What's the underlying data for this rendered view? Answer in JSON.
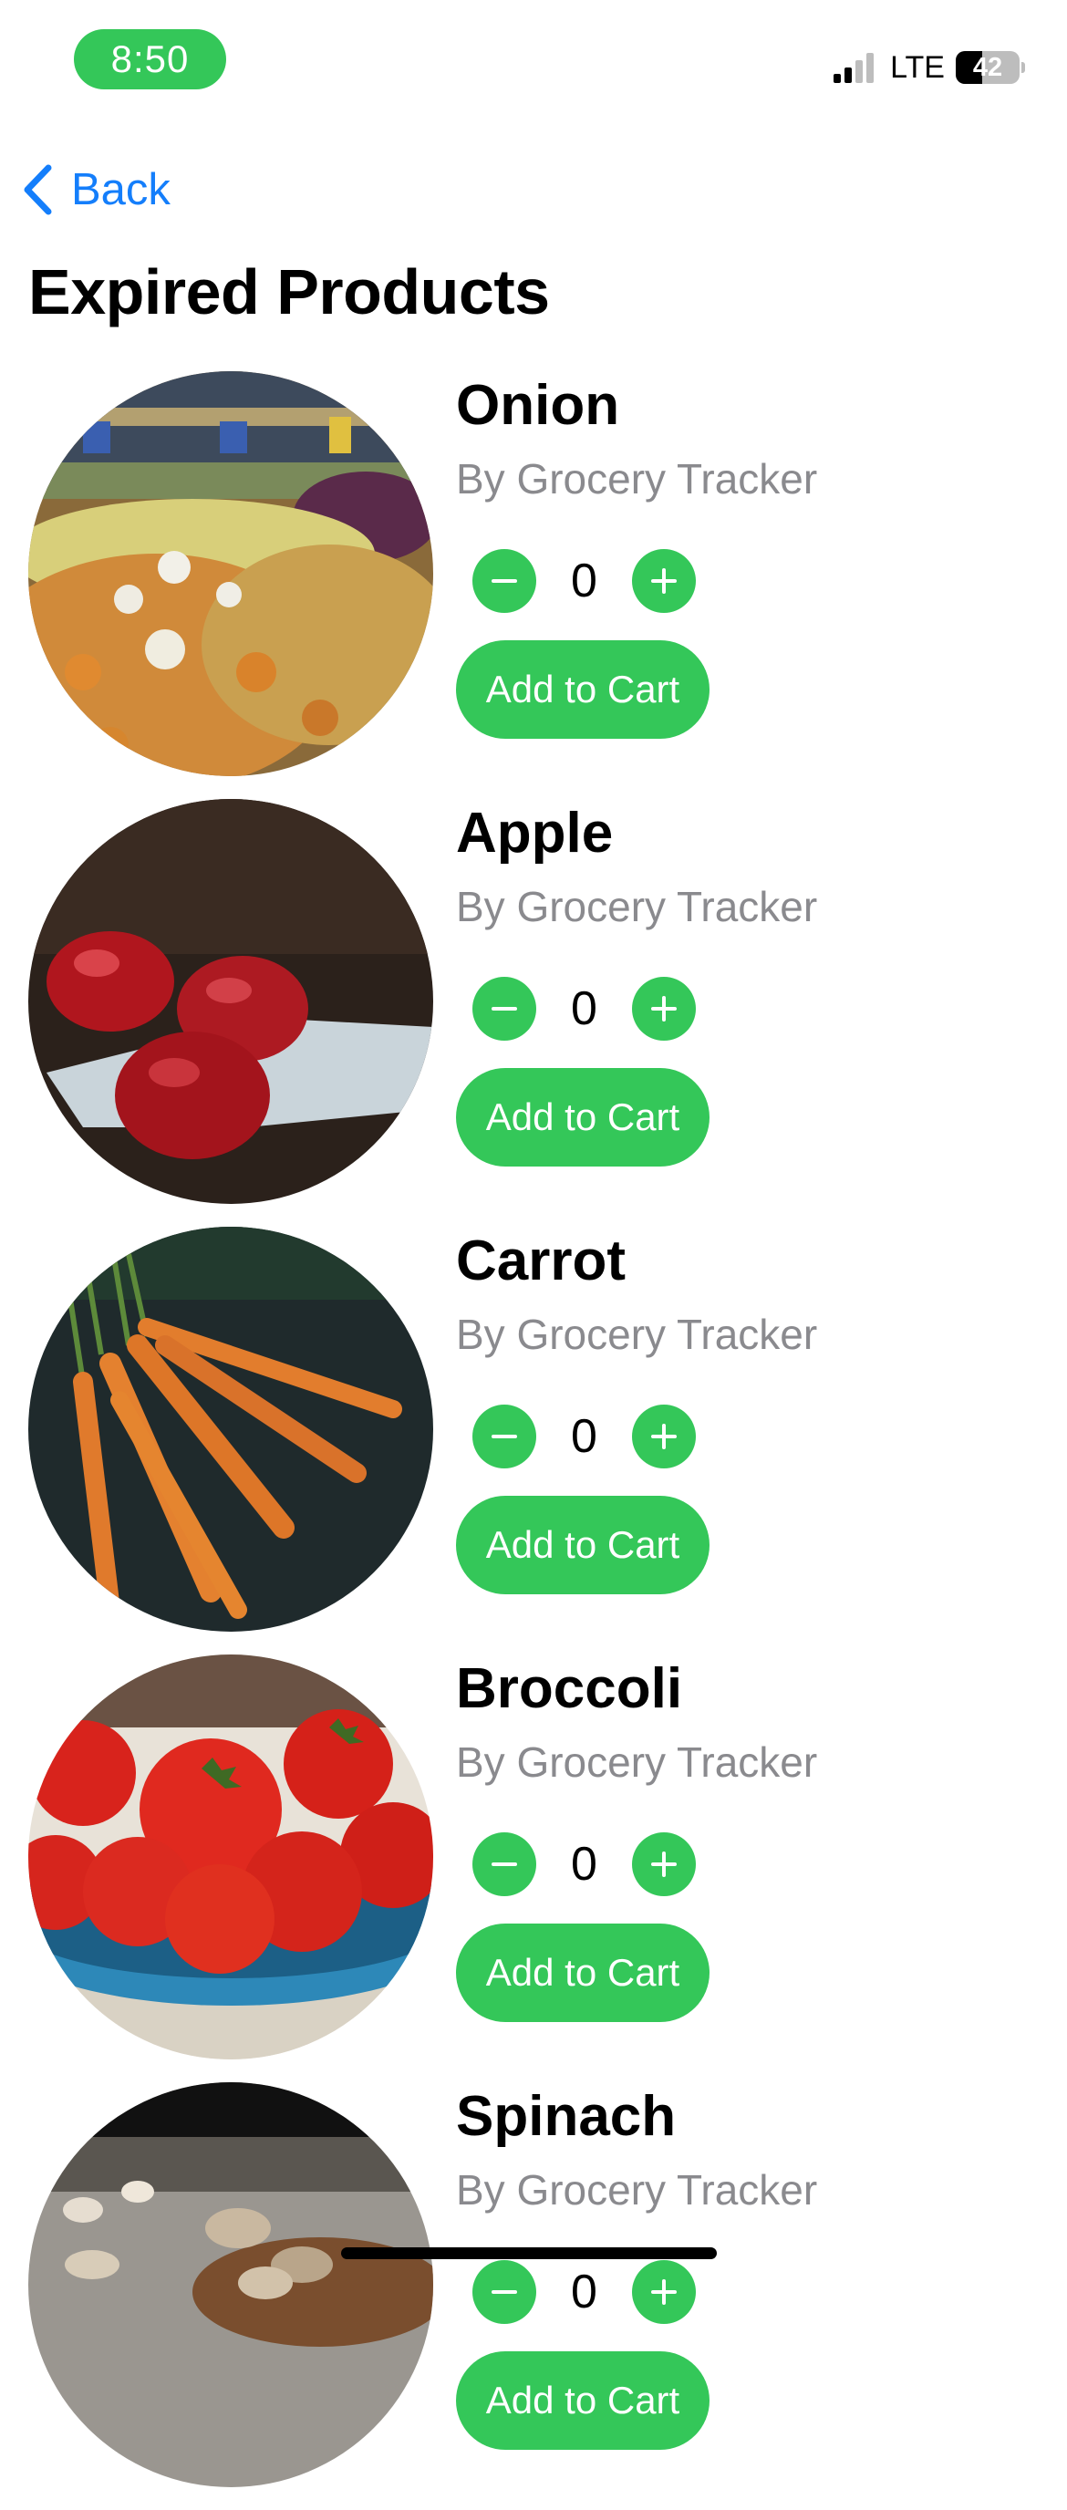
{
  "status_bar": {
    "time": "8:50",
    "network": "LTE",
    "battery_percent": "42",
    "signal_bars_filled": 2,
    "signal_bars_total": 4,
    "time_pill_color": "#34c759"
  },
  "nav": {
    "back_label": "Back",
    "back_icon": "chevron-left-icon"
  },
  "page": {
    "title": "Expired Products"
  },
  "products": [
    {
      "name": "Onion",
      "byline": "By Grocery Tracker",
      "quantity": "0",
      "add_label": "Add to Cart",
      "image": "onions-market-photo"
    },
    {
      "name": "Apple",
      "byline": "By Grocery Tracker",
      "quantity": "0",
      "add_label": "Add to Cart",
      "image": "red-apples-photo"
    },
    {
      "name": "Carrot",
      "byline": "By Grocery Tracker",
      "quantity": "0",
      "add_label": "Add to Cart",
      "image": "carrots-photo"
    },
    {
      "name": "Broccoli",
      "byline": "By Grocery Tracker",
      "quantity": "0",
      "add_label": "Add to Cart",
      "image": "tomatoes-bowl-photo"
    },
    {
      "name": "Spinach",
      "byline": "By Grocery Tracker",
      "quantity": "0",
      "add_label": "Add to Cart",
      "image": "mushrooms-photo"
    }
  ],
  "colors": {
    "accent_green": "#34c759",
    "link_blue": "#147efb",
    "secondary_text": "#8a8a8e"
  }
}
